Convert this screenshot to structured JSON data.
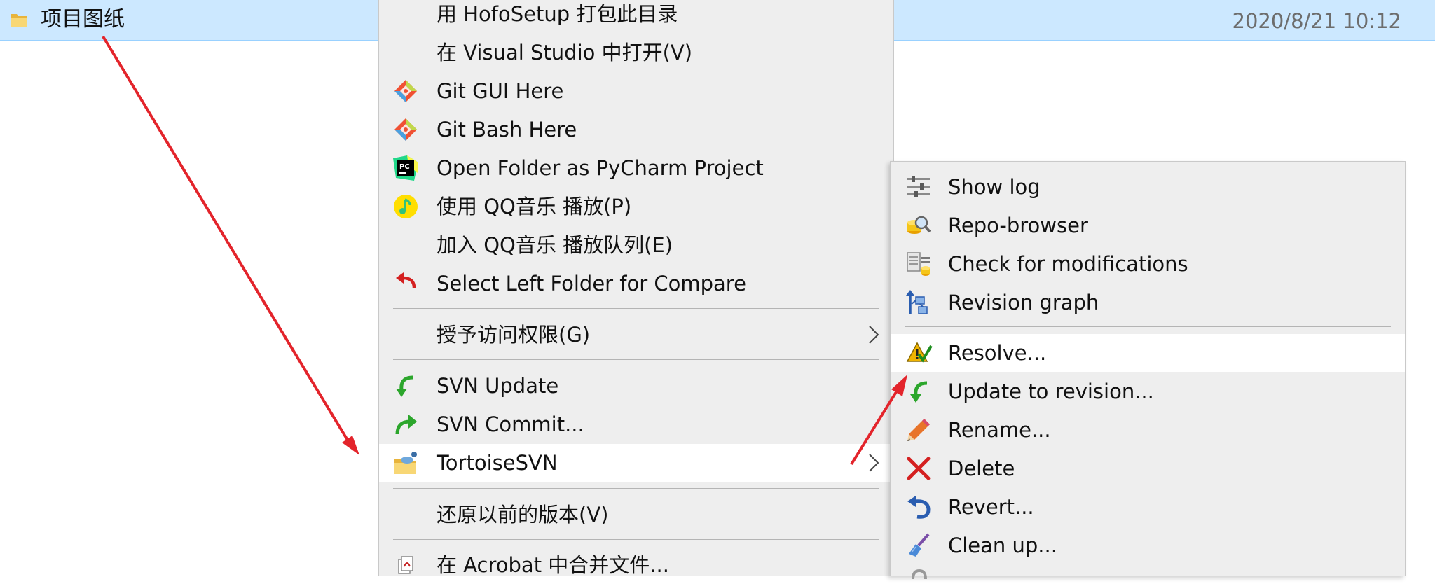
{
  "explorer": {
    "folder_name": "项目图纸",
    "folder_date": "2020/8/21 10:12"
  },
  "context_menu": {
    "items": [
      {
        "label": "用 HofoSetup 打包此目录",
        "icon": "none"
      },
      {
        "label": "在 Visual Studio 中打开(V)",
        "icon": "none"
      },
      {
        "label": "Git GUI Here",
        "icon": "git-icon"
      },
      {
        "label": "Git Bash Here",
        "icon": "git-icon"
      },
      {
        "label": "Open Folder as PyCharm Project",
        "icon": "pycharm-icon"
      },
      {
        "label": "使用 QQ音乐 播放(P)",
        "icon": "qq-music-icon"
      },
      {
        "label": "加入 QQ音乐 播放队列(E)",
        "icon": "none"
      },
      {
        "label": "Select Left Folder for Compare",
        "icon": "compare-arrow-icon"
      },
      {
        "label": "授予访问权限(G)",
        "icon": "none"
      },
      {
        "label": "SVN Update",
        "icon": "svn-update-icon"
      },
      {
        "label": "SVN Commit...",
        "icon": "svn-commit-icon"
      },
      {
        "label": "TortoiseSVN",
        "icon": "tortoisesvn-icon"
      },
      {
        "label": "还原以前的版本(V)",
        "icon": "none"
      },
      {
        "label": "在 Acrobat 中合并文件...",
        "icon": "acrobat-icon"
      }
    ]
  },
  "tortoise_submenu": {
    "items": [
      {
        "label": "Show log",
        "icon": "show-log-icon"
      },
      {
        "label": "Repo-browser",
        "icon": "repo-browser-icon"
      },
      {
        "label": "Check for modifications",
        "icon": "check-modifications-icon"
      },
      {
        "label": "Revision graph",
        "icon": "revision-graph-icon"
      },
      {
        "label": "Resolve...",
        "icon": "resolve-icon"
      },
      {
        "label": "Update to revision...",
        "icon": "update-revision-icon"
      },
      {
        "label": "Rename...",
        "icon": "rename-pencil-icon"
      },
      {
        "label": "Delete",
        "icon": "delete-x-icon"
      },
      {
        "label": "Revert...",
        "icon": "revert-icon"
      },
      {
        "label": "Clean up...",
        "icon": "cleanup-brush-icon"
      }
    ]
  },
  "colors": {
    "selection": "#cce8ff",
    "menu_bg": "#eeeeee",
    "highlight": "#ffffff",
    "annotation_arrow": "#e3242b"
  }
}
